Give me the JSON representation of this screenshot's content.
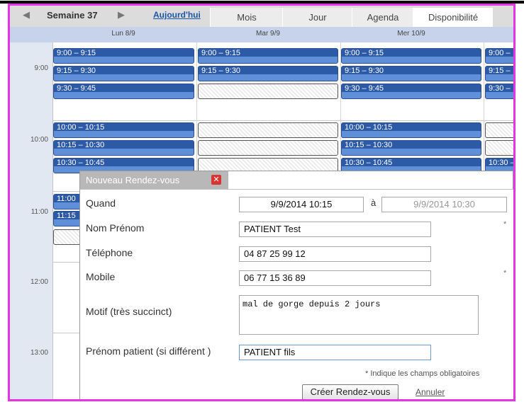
{
  "toolbar": {
    "prev_icon": "◀",
    "next_icon": "▶",
    "week_label": "Semaine 37",
    "today_link": "Aujourd'hui",
    "tabs": [
      "Mois",
      "Jour",
      "Agenda",
      "Disponibilité"
    ]
  },
  "days": [
    "Lun 8/9",
    "Mar 9/9",
    "Mer 10/9"
  ],
  "times": [
    "9:00",
    "10:00",
    "11:00",
    "12:00",
    "13:00"
  ],
  "slots": {
    "mon": [
      "9:00 – 9:15",
      "9:15 – 9:30",
      "9:30 – 9:45",
      "10:00 – 10:15",
      "10:15 – 10:30",
      "10:30 – 10:45",
      "11:00",
      "11:15"
    ],
    "tue": [
      "9:00 – 9:15",
      "9:15 – 9:30"
    ],
    "wed": [
      "9:00 – 9:15",
      "9:15 – 9:30",
      "9:30 – 9:45",
      "10:00 – 10:15",
      "10:15 – 10:30",
      "10:30 – 10:45"
    ],
    "thu": [
      "9:00 –",
      "9:15 –",
      "9:30 –",
      "10:30 –"
    ]
  },
  "dialog": {
    "title": "Nouveau Rendez-vous",
    "close_icon": "✕",
    "quand_label": "Quand",
    "start_value": "9/9/2014  10:15",
    "a_label": "à",
    "end_value": "9/9/2014  10:30",
    "nom_label": "Nom Prénom",
    "nom_value": "PATIENT Test",
    "tel_label": "Téléphone",
    "tel_value": "04 87 25 99 12",
    "mobile_label": "Mobile",
    "mobile_value": "06 77 15 36 89",
    "motif_label": "Motif (très succinct)",
    "motif_value": "mal de gorge depuis 2 jours",
    "prenom_label": "Prénom patient (si différent )",
    "prenom_value": "PATIENT fils",
    "required_mark": "*",
    "required_note": "* Indique les champs obligatoires",
    "create_button": "Créer Rendez-vous",
    "cancel_link": "Annuler"
  },
  "colors": {
    "frame_border": "#e832e8",
    "slot_fill": "#5f8fd6",
    "slot_top": "#2c5aa6"
  }
}
